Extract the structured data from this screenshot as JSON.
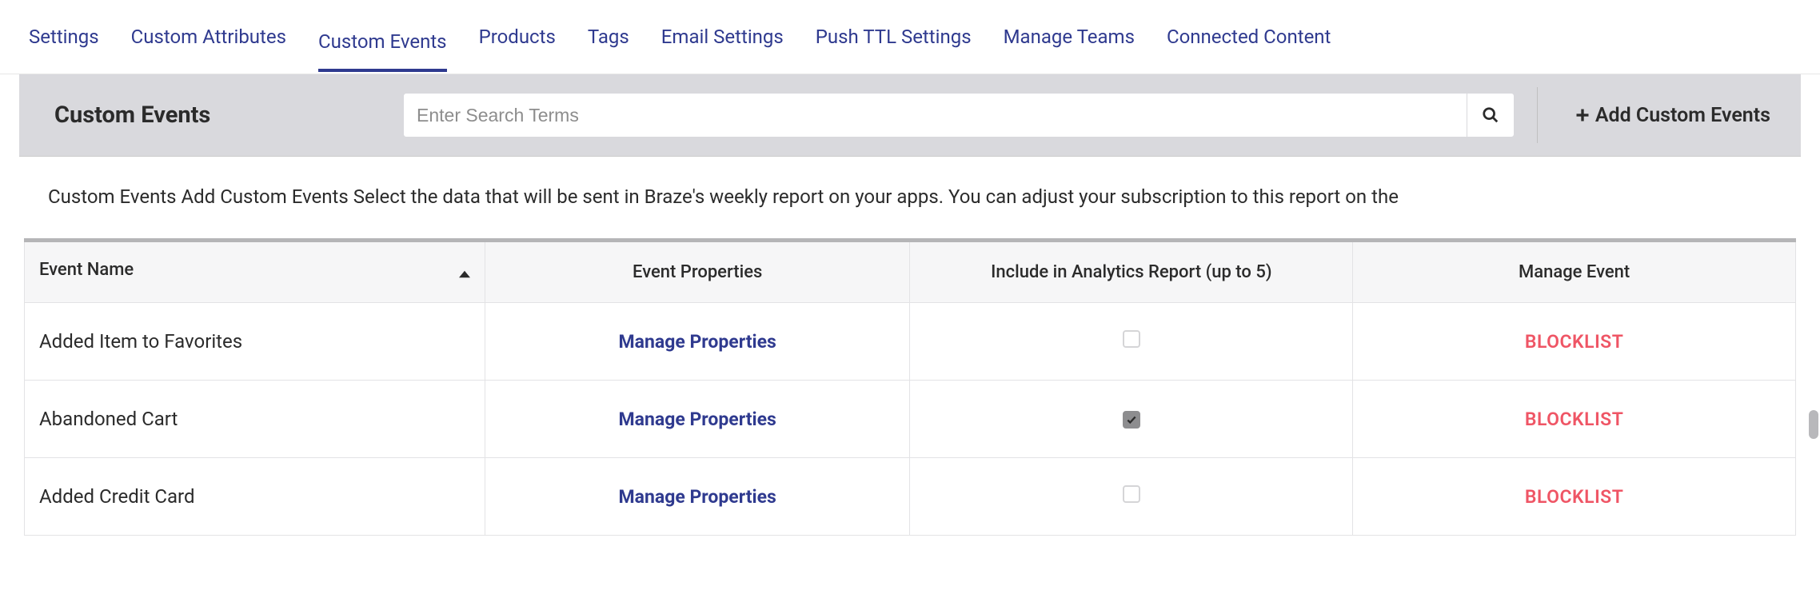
{
  "nav": {
    "items": [
      {
        "label": "Settings",
        "id": "settings",
        "active": false
      },
      {
        "label": "Custom Attributes",
        "id": "custom-attributes",
        "active": false
      },
      {
        "label": "Custom Events",
        "id": "custom-events",
        "active": true
      },
      {
        "label": "Products",
        "id": "products",
        "active": false
      },
      {
        "label": "Tags",
        "id": "tags",
        "active": false
      },
      {
        "label": "Email Settings",
        "id": "email-settings",
        "active": false
      },
      {
        "label": "Push TTL Settings",
        "id": "push-ttl-settings",
        "active": false
      },
      {
        "label": "Manage Teams",
        "id": "manage-teams",
        "active": false
      },
      {
        "label": "Connected Content",
        "id": "connected-content",
        "active": false
      }
    ]
  },
  "header": {
    "title": "Custom Events",
    "search_placeholder": "Enter Search Terms",
    "add_label": "Add Custom Events"
  },
  "description": "Custom Events Add Custom Events Select the data that will be sent in Braze's weekly report on your apps. You can adjust your subscription to this report on the",
  "table": {
    "columns": {
      "event_name": "Event Name",
      "event_properties": "Event Properties",
      "include_analytics": "Include in Analytics Report (up to 5)",
      "manage_event": "Manage Event"
    },
    "manage_properties_label": "Manage Properties",
    "blocklist_label": "BLOCKLIST",
    "rows": [
      {
        "name": "Added Item to Favorites",
        "include": false
      },
      {
        "name": "Abandoned Cart",
        "include": true
      },
      {
        "name": "Added Credit Card",
        "include": false
      }
    ]
  }
}
